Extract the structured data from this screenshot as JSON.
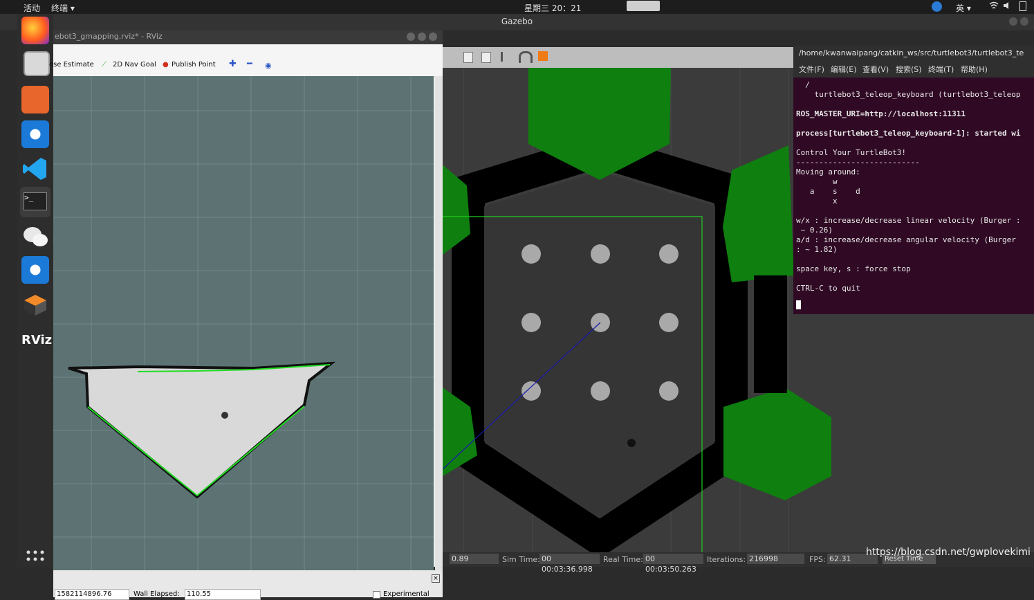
{
  "topbar": {
    "activities": "活动",
    "app_menu": "终端 ▾",
    "clock": "星期三 20：21",
    "lang": "英 ▾"
  },
  "gazebo": {
    "title": "Gazebo",
    "status": {
      "rtf_value": "0.89",
      "sim_time_label": "Sim Time:",
      "sim_time": "00 00:03:36.998",
      "real_time_label": "Real Time:",
      "real_time": "00 00:03:50.263",
      "iterations_label": "Iterations:",
      "iterations": "216998",
      "fps_label": "FPS:",
      "fps": "62.31",
      "reset_time": "Reset Time"
    }
  },
  "rviz": {
    "title": "ebot3_gmapping.rviz* - RViz",
    "toolbar": {
      "pose_estimate": "ose Estimate",
      "nav_goal": "2D Nav Goal",
      "publish_point": "Publish Point"
    },
    "bottom": {
      "ros_time": "1582114896.76",
      "wall_elapsed_label": "Wall Elapsed:",
      "wall_elapsed": "110.55",
      "experimental": "Experimental"
    }
  },
  "terminal": {
    "title": "/home/kwanwaipang/catkin_ws/src/turtlebot3/turtlebot3_te",
    "menu": [
      "文件(F)",
      "编辑(E)",
      "查看(V)",
      "搜索(S)",
      "终端(T)",
      "帮助(H)"
    ],
    "lines": [
      "  /",
      "    turtlebot3_teleop_keyboard (turtlebot3_teleop",
      "",
      "ROS_MASTER_URI=http://localhost:11311",
      "",
      "process[turtlebot3_teleop_keyboard-1]: started wi",
      "",
      "Control Your TurtleBot3!",
      "---------------------------",
      "Moving around:",
      "        w",
      "   a    s    d",
      "        x",
      "",
      "w/x : increase/decrease linear velocity (Burger :",
      " ~ 0.26)",
      "a/d : increase/decrease angular velocity (Burger",
      ": ~ 1.82)",
      "",
      "space key, s : force stop",
      "",
      "CTRL-C to quit"
    ]
  },
  "watermark": "https://blog.csdn.net/gwplovekimi",
  "colors": {
    "map_bg": "#5d7373",
    "free_space": "#d9d9d9",
    "laser": "#22dd22",
    "terminal_bg": "#300a24",
    "gazebo_obstacle": "#0f7f0f"
  }
}
